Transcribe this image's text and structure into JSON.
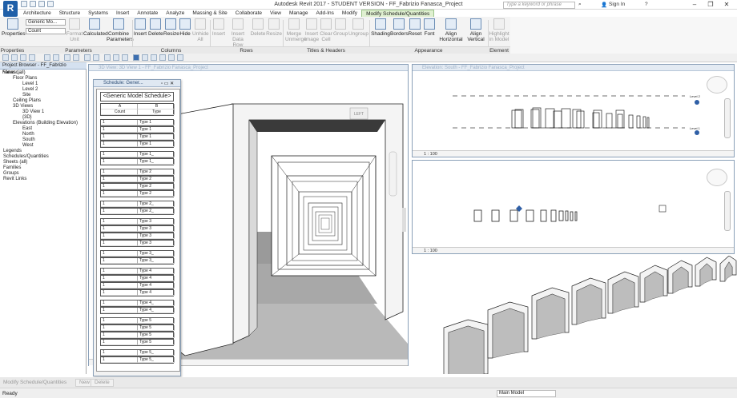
{
  "title": "Autodesk Revit 2017 - STUDENT VERSION -   FF_Fabrizio Fanasca_Project",
  "search_placeholder": "Type a keyword or phrase",
  "sign_in": "Sign In",
  "tabs": [
    "Architecture",
    "Structure",
    "Systems",
    "Insert",
    "Annotate",
    "Analyze",
    "Massing & Site",
    "Collaborate",
    "View",
    "Manage",
    "Add-Ins",
    "Modify",
    "Modify Schedule/Quantities"
  ],
  "ribbon": {
    "properties_label": "Properties",
    "type_combo": "Generic Mo...",
    "param_combo": "Count",
    "buttons": [
      {
        "label": "Format Unit",
        "disabled": true
      },
      {
        "label": "Calculated",
        "disabled": false
      },
      {
        "label": "Combine Parameters",
        "disabled": false
      },
      {
        "label": "Insert",
        "disabled": false
      },
      {
        "label": "Delete",
        "disabled": false
      },
      {
        "label": "Resize",
        "disabled": false
      },
      {
        "label": "Hide",
        "disabled": false
      },
      {
        "label": "Unhide All",
        "disabled": true
      },
      {
        "label": "Insert",
        "disabled": true
      },
      {
        "label": "Insert Data Row",
        "disabled": true
      },
      {
        "label": "Delete",
        "disabled": true
      },
      {
        "label": "Resize",
        "disabled": true
      },
      {
        "label": "Merge Unmerge",
        "disabled": true
      },
      {
        "label": "Insert Image",
        "disabled": true
      },
      {
        "label": "Clear Cell",
        "disabled": true
      },
      {
        "label": "Group",
        "disabled": true
      },
      {
        "label": "Ungroup",
        "disabled": true
      },
      {
        "label": "Shading",
        "disabled": false
      },
      {
        "label": "Borders",
        "disabled": false
      },
      {
        "label": "Reset",
        "disabled": false
      },
      {
        "label": "Font",
        "disabled": false
      },
      {
        "label": "Align Horizontal",
        "disabled": false
      },
      {
        "label": "Align Vertical",
        "disabled": false
      },
      {
        "label": "Highlight in Model",
        "disabled": true
      }
    ],
    "groups": [
      "Properties",
      "Parameters",
      "Columns",
      "Rows",
      "Titles & Headers",
      "Appearance",
      "Element"
    ]
  },
  "project_browser": {
    "title": "Project Browser - FF_Fabrizio Fanasc...",
    "items": [
      {
        "label": "Views (all)",
        "level": 0
      },
      {
        "label": "Floor Plans",
        "level": 1
      },
      {
        "label": "Level 1",
        "level": 2
      },
      {
        "label": "Level 2",
        "level": 2
      },
      {
        "label": "Site",
        "level": 2
      },
      {
        "label": "Ceiling Plans",
        "level": 1
      },
      {
        "label": "3D Views",
        "level": 1
      },
      {
        "label": "3D View 1",
        "level": 2
      },
      {
        "label": "{3D}",
        "level": 2
      },
      {
        "label": "Elevations (Building Elevation)",
        "level": 1
      },
      {
        "label": "East",
        "level": 2
      },
      {
        "label": "North",
        "level": 2
      },
      {
        "label": "South",
        "level": 2
      },
      {
        "label": "West",
        "level": 2
      },
      {
        "label": "Legends",
        "level": 0
      },
      {
        "label": "Schedules/Quantities",
        "level": 0
      },
      {
        "label": "Sheets (all)",
        "level": 0
      },
      {
        "label": "Families",
        "level": 0
      },
      {
        "label": "Groups",
        "level": 0
      },
      {
        "label": "Revit Links",
        "level": 0
      }
    ]
  },
  "view3d_title": "3D View: 3D View 1 - FF_Fabrizio Fanasca_Project",
  "view_elev_title": "Elevation: South - FF_Fabrizio Fanasca_Project",
  "scale": "1 : 100",
  "cube_label": "LEFT",
  "level_tags": [
    "Level 2",
    "Level 1"
  ],
  "schedule": {
    "window_title": "Schedule: Gener...",
    "title": "<Generic Model Schedule>",
    "col_letters": [
      "A",
      "B"
    ],
    "col_headers": [
      "Count",
      "Type"
    ],
    "rows": [
      [
        "1",
        "Type 1"
      ],
      [
        "1",
        "Type 1"
      ],
      [
        "1",
        "Type 1"
      ],
      [
        "1",
        "Type 1"
      ],
      [
        "1",
        "Type 1_"
      ],
      [
        "1",
        "Type 1_"
      ],
      [
        "1",
        "Type 2"
      ],
      [
        "1",
        "Type 2"
      ],
      [
        "1",
        "Type 2"
      ],
      [
        "1",
        "Type 2"
      ],
      [
        "1",
        "Type 2_"
      ],
      [
        "1",
        "Type 2_"
      ],
      [
        "1",
        "Type 3"
      ],
      [
        "1",
        "Type 3"
      ],
      [
        "1",
        "Type 3"
      ],
      [
        "1",
        "Type 3"
      ],
      [
        "1",
        "Type 3_"
      ],
      [
        "1",
        "Type 3_"
      ],
      [
        "1",
        "Type 4"
      ],
      [
        "1",
        "Type 4"
      ],
      [
        "1",
        "Type 4"
      ],
      [
        "1",
        "Type 4"
      ],
      [
        "1",
        "Type 4_"
      ],
      [
        "1",
        "Type 4_"
      ],
      [
        "1",
        "Type 5"
      ],
      [
        "1",
        "Type 5"
      ],
      [
        "1",
        "Type 5"
      ],
      [
        "1",
        "Type 5"
      ],
      [
        "1",
        "Type 5_"
      ],
      [
        "1",
        "Type 5_"
      ]
    ]
  },
  "context_bar": {
    "label": "Modify Schedule/Quantities",
    "new": "New",
    "delete": "Delete"
  },
  "status": {
    "ready": "Ready",
    "model": "Main Model"
  }
}
